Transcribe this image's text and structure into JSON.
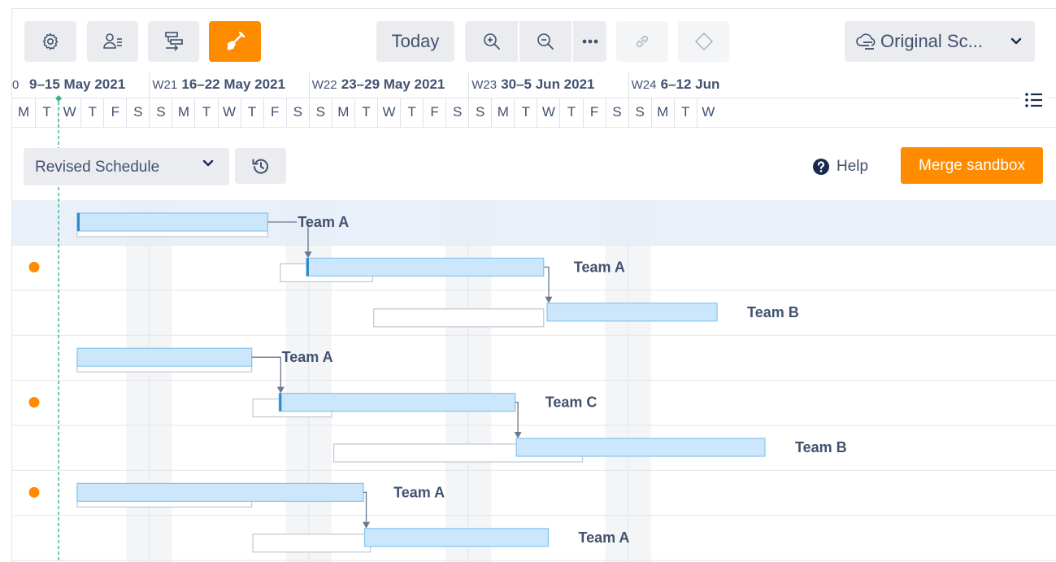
{
  "toolbar": {
    "buttons": [
      {
        "name": "settings",
        "icon": "gear-icon"
      },
      {
        "name": "resources",
        "icon": "user-list-icon"
      },
      {
        "name": "structure",
        "icon": "hierarchy-icon"
      },
      {
        "name": "sandbox",
        "icon": "shovel-icon",
        "active": true
      }
    ],
    "today_label": "Today",
    "zoom_in_icon": "zoom-in-icon",
    "zoom_out_icon": "zoom-out-icon",
    "more_icon": "more-icon",
    "link_icon": "link-icon",
    "milestone_icon": "diamond-icon",
    "schedule_view_label": "Original Sc...",
    "schedule_view_icon": "cloud-schedule-icon"
  },
  "timeline": {
    "weeks": [
      {
        "wk": "0",
        "range": "9–15 May 2021"
      },
      {
        "wk": "W21",
        "range": "16–22 May 2021"
      },
      {
        "wk": "W22",
        "range": "23–29 May 2021"
      },
      {
        "wk": "W23",
        "range": "30–5 Jun 2021"
      },
      {
        "wk": "W24",
        "range": "6–12 Jun"
      }
    ],
    "days": [
      "M",
      "T",
      "W",
      "T",
      "F",
      "S",
      "S",
      "M",
      "T",
      "W",
      "T",
      "F",
      "S",
      "S",
      "M",
      "T",
      "W",
      "T",
      "F",
      "S",
      "S",
      "M",
      "T",
      "W",
      "T",
      "F",
      "S",
      "S",
      "M",
      "T",
      "W"
    ],
    "today_index": 2
  },
  "sandbox_bar": {
    "schedule_label": "Revised Schedule",
    "history_icon": "history-icon",
    "help_label": "Help",
    "merge_label": "Merge sandbox"
  },
  "colors": {
    "accent": "#ff8b00",
    "bar_fill": "#cce6fc",
    "bar_border": "#84c6ef",
    "bar_start": "#2d8bc9",
    "baseline": "#c1c7d0",
    "today_line": "#36b37e",
    "weekend": "#f4f5f7",
    "selected_row": "#e6edf8",
    "dot": "#ff8b00"
  },
  "rows": [
    {
      "label": "Team A",
      "selected": true,
      "dot": false,
      "bar": [
        2.85,
        11.2
      ],
      "base": [
        2.85,
        11.2
      ],
      "start_marker": true
    },
    {
      "label": "Team A",
      "selected": false,
      "dot": true,
      "bar": [
        12.9,
        23.3
      ],
      "base": [
        11.75,
        15.8
      ],
      "start_marker": true
    },
    {
      "label": "Team B",
      "selected": false,
      "dot": false,
      "bar": [
        23.45,
        30.9
      ],
      "base": [
        15.85,
        23.3
      ],
      "start_marker": false
    },
    {
      "label": "Team A",
      "selected": false,
      "dot": false,
      "bar": [
        2.85,
        10.5
      ],
      "base": [
        2.85,
        10.5
      ],
      "start_marker": false
    },
    {
      "label": "Team C",
      "selected": false,
      "dot": true,
      "bar": [
        11.7,
        22.05
      ],
      "base": [
        10.55,
        14.0
      ],
      "start_marker": true
    },
    {
      "label": "Team B",
      "selected": false,
      "dot": false,
      "bar": [
        22.1,
        33.0
      ],
      "base": [
        14.1,
        25.0
      ],
      "start_marker": false
    },
    {
      "label": "Team A",
      "selected": false,
      "dot": true,
      "bar": [
        2.85,
        15.4
      ],
      "base": [
        2.85,
        10.5
      ],
      "start_marker": false
    },
    {
      "label": "Team A",
      "selected": false,
      "dot": false,
      "bar": [
        15.45,
        23.5
      ],
      "base": [
        10.55,
        15.7
      ],
      "start_marker": false
    }
  ],
  "dependencies": [
    {
      "from": 0,
      "to": 1
    },
    {
      "from": 1,
      "to": 2
    },
    {
      "from": 3,
      "to": 4
    },
    {
      "from": 4,
      "to": 5
    },
    {
      "from": 6,
      "to": 7
    }
  ]
}
